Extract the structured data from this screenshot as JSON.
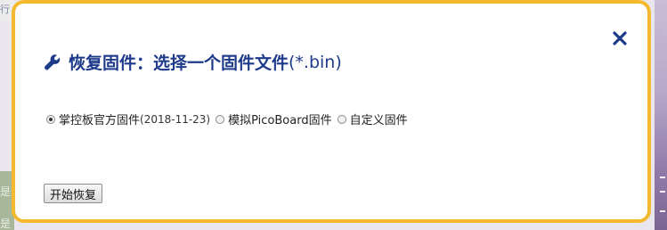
{
  "background": {
    "left_top_fragment": "行",
    "left_fragment_1": "是",
    "left_fragment_2": "是"
  },
  "modal": {
    "title_main": "恢复固件：选择一个固件文件",
    "title_suffix": "(*.bin)",
    "title_icon": "wrench-icon",
    "close_icon": "close-icon",
    "options": [
      {
        "label": "掌控板官方固件",
        "extra": "(2018-11-23)",
        "checked": true
      },
      {
        "label": "模拟PicoBoard固件",
        "extra": "",
        "checked": false
      },
      {
        "label": "自定义固件",
        "extra": "",
        "checked": false
      }
    ],
    "start_button": "开始恢复"
  },
  "colors": {
    "modal_border": "#f5b92f",
    "title": "#1e3a8a"
  }
}
